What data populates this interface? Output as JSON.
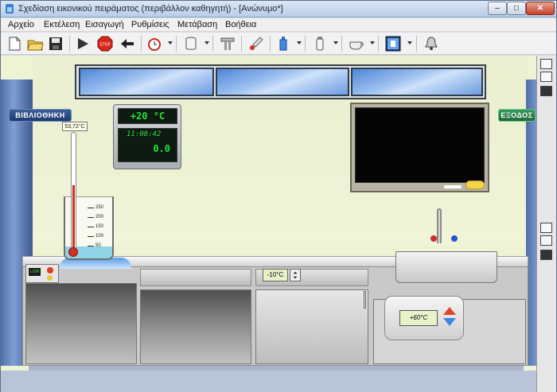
{
  "window": {
    "title": "Σχεδίαση εικονικού πειράματος (περιβάλλον καθηγητή) - [Ανώνυμο*]",
    "minimize_glyph": "–",
    "maximize_glyph": "□",
    "close_glyph": "✕"
  },
  "menu": {
    "items": [
      {
        "label": "Αρχείο"
      },
      {
        "label": "Εκτέλεση"
      },
      {
        "label": "Εισαγωγή"
      },
      {
        "label": "Ρυθμίσεις"
      },
      {
        "label": "Μετάβαση"
      },
      {
        "label": "Βοήθεια"
      }
    ]
  },
  "toolbar": {
    "icons": [
      "new-file-icon",
      "open-folder-icon",
      "save-icon",
      "play-icon",
      "stop-icon",
      "back-arrow-icon",
      "alarm-clock-icon",
      "container-icon",
      "stand-icon",
      "thermometer-icon",
      "flask-icon",
      "cylinder-icon",
      "cup-icon",
      "display-icon",
      "bell-icon"
    ]
  },
  "scene": {
    "library_label": "ΒΙΒΛΙΟΘΗΚΗ",
    "exit_label": "ΕΞΟΔΟΣ",
    "room_temperature": "+20 °C",
    "clock_time": "11:08:42",
    "counter_value": "0.0",
    "thermometer_reading": "53,72°C",
    "beaker_graduations": [
      "250",
      "200",
      "150",
      "100",
      "50"
    ],
    "cold_chamber_temp": "-10°C",
    "water_heater_temp": "+60°C",
    "heater_indicator": "LOW"
  },
  "colors": {
    "display_green": "#27e23b",
    "door_blue": "#4f6ea6",
    "exit_green": "#3c9a5d",
    "heat_red": "#e2452b",
    "cool_blue": "#3a88e0"
  }
}
